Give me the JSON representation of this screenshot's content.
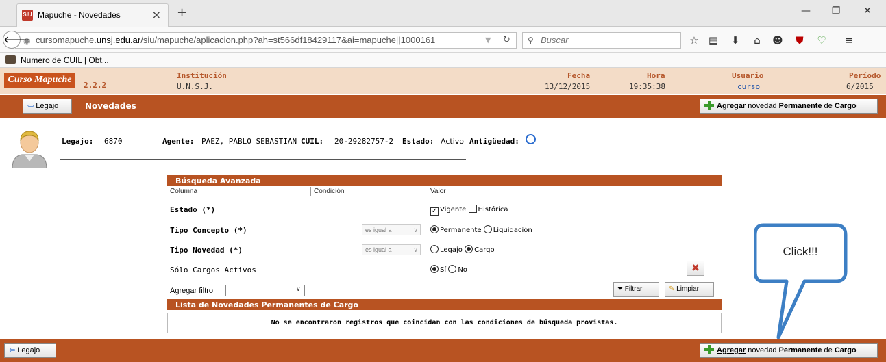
{
  "browser": {
    "tab_title": "Mapuche - Novedades",
    "favicon_text": "SIU",
    "tab_close": "×",
    "new_tab": "+",
    "window_controls": [
      "—",
      "❐",
      "✕"
    ],
    "url_host": "cursomapuche.",
    "url_domain": "unsj.edu.ar",
    "url_path": "/siu/mapuche/aplicacion.php?ah=st566df18429117&ai=mapuche||1000161",
    "search_placeholder": "Buscar",
    "bookmark_label": "Numero de CUIL | Obt..."
  },
  "header": {
    "logo": "Curso Mapuche",
    "version": "2.2.2",
    "institucion_label": "Institución",
    "institucion_value": "U.N.S.J.",
    "fecha_label": "Fecha",
    "fecha_value": "13/12/2015",
    "hora_label": "Hora",
    "hora_value": "19:35:38",
    "usuario_label": "Usuario",
    "usuario_value": "curso",
    "periodo_label": "Período",
    "periodo_value": "6/2015"
  },
  "titlebar": {
    "legajo_button": "Legajo",
    "title": "Novedades",
    "add_prefix": "Agregar",
    "add_middle1": " novedad ",
    "add_bold": "Permanente",
    "add_middle2": " de ",
    "add_suffix": "Cargo"
  },
  "agent": {
    "legajo_label": "Legajo:",
    "legajo_value": "6870",
    "agente_label": "Agente:",
    "agente_value": "PAEZ, PABLO SEBASTIAN",
    "cuil_label": "CUIL:",
    "cuil_value": "20-29282757-2",
    "estado_label": "Estado:",
    "estado_value": "Activo",
    "antiguedad_label": "Antigüedad:"
  },
  "search": {
    "title": "Búsqueda Avanzada",
    "col_columna": "Columna",
    "col_condicion": "Condición",
    "col_valor": "Valor",
    "rows": [
      {
        "label": "Estado (*)"
      },
      {
        "label": "Tipo Concepto (*)",
        "condition": "es igual a"
      },
      {
        "label": "Tipo Novedad (*)",
        "condition": "es igual a"
      },
      {
        "label": "Sólo Cargos Activos"
      }
    ],
    "estado_vigente": "Vigente",
    "estado_historica": "Histórica",
    "concepto_permanente": "Permanente",
    "concepto_liquidacion": "Liquidación",
    "novedad_legajo": "Legajo",
    "novedad_cargo": "Cargo",
    "activos_si": "Sí",
    "activos_no": "No",
    "agregar_filtro": "Agregar filtro",
    "filtrar": "Filtrar",
    "limpiar": "Limpiar"
  },
  "list": {
    "title": "Lista de Novedades Permanentes de Cargo",
    "empty_message": "No se encontraron registros que coincidan con las condiciones de búsqueda provistas."
  },
  "callout": {
    "text": "Click!!!"
  },
  "colors": {
    "accent": "#b85322",
    "header_bg": "#f3dcc7",
    "callout_border": "#3d7fc4"
  }
}
